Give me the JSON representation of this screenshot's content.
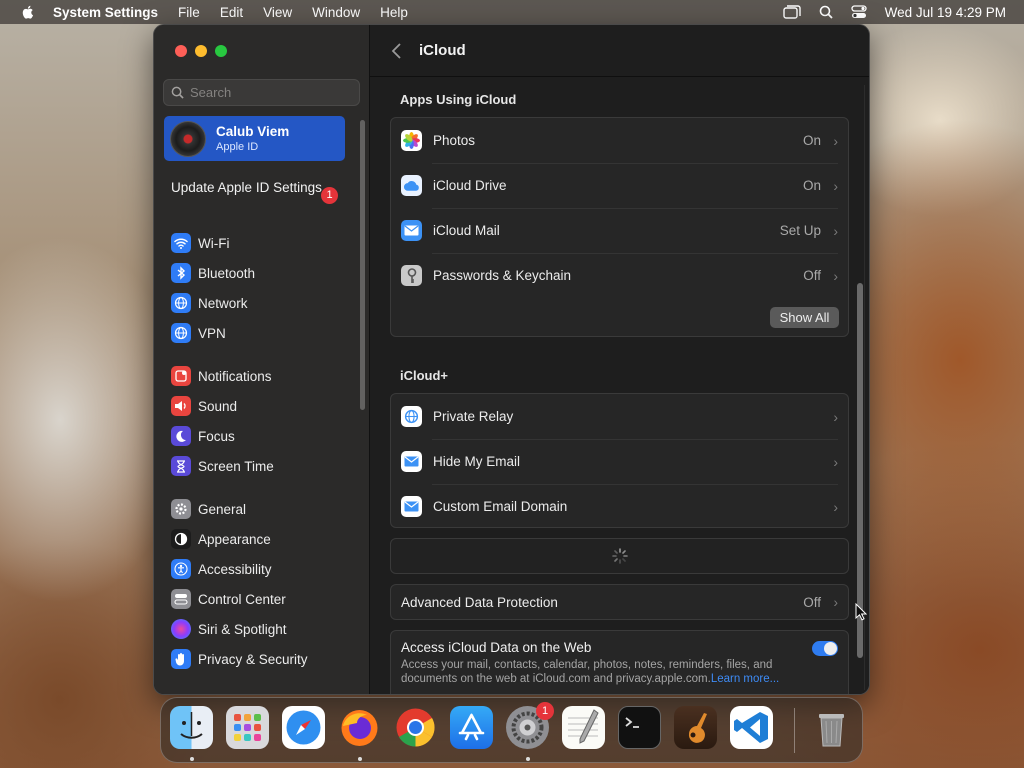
{
  "menubar": {
    "app_name": "System Settings",
    "menus": [
      "File",
      "Edit",
      "View",
      "Window",
      "Help"
    ],
    "clock": "Wed Jul 19  4:29 PM",
    "status_icons": [
      "window-icon",
      "search-icon",
      "control-center-icon"
    ]
  },
  "sidebar": {
    "search_placeholder": "Search",
    "account": {
      "name": "Calub Viem",
      "subtitle": "Apple ID"
    },
    "update": {
      "label": "Update Apple ID Settings",
      "badge": "1"
    },
    "items": [
      {
        "label": "Wi-Fi",
        "icon": "wifi-icon",
        "color": "#2f7cf6"
      },
      {
        "label": "Bluetooth",
        "icon": "bluetooth-icon",
        "color": "#2f7cf6"
      },
      {
        "label": "Network",
        "icon": "globe-icon",
        "color": "#2f7cf6"
      },
      {
        "label": "VPN",
        "icon": "vpn-globe-icon",
        "color": "#2f7cf6"
      },
      {
        "label": "Notifications",
        "icon": "bell-icon",
        "color": "#e9453f"
      },
      {
        "label": "Sound",
        "icon": "speaker-icon",
        "color": "#e9453f"
      },
      {
        "label": "Focus",
        "icon": "moon-icon",
        "color": "#5a4ad8"
      },
      {
        "label": "Screen Time",
        "icon": "hourglass-icon",
        "color": "#5a4ad8"
      },
      {
        "label": "General",
        "icon": "gear-icon",
        "color": "#8e8e93"
      },
      {
        "label": "Appearance",
        "icon": "appearance-icon",
        "color": "#1c1c1c"
      },
      {
        "label": "Accessibility",
        "icon": "accessibility-icon",
        "color": "#2f7cf6"
      },
      {
        "label": "Control Center",
        "icon": "control-center-icon",
        "color": "#8e8e93"
      },
      {
        "label": "Siri & Spotlight",
        "icon": "siri-icon",
        "color": "#b044d6"
      },
      {
        "label": "Privacy & Security",
        "icon": "hand-icon",
        "color": "#2f7cf6"
      }
    ]
  },
  "header": {
    "title": "iCloud"
  },
  "apps_section": {
    "title": "Apps Using iCloud",
    "rows": [
      {
        "label": "Photos",
        "value": "On",
        "icon": "photos-icon"
      },
      {
        "label": "iCloud Drive",
        "value": "On",
        "icon": "icloud-drive-icon"
      },
      {
        "label": "iCloud Mail",
        "value": "Set Up",
        "icon": "mail-icon"
      },
      {
        "label": "Passwords & Keychain",
        "value": "Off",
        "icon": "key-icon"
      }
    ],
    "show_all": "Show All"
  },
  "plus_section": {
    "title": "iCloud+",
    "rows": [
      {
        "label": "Private Relay",
        "icon": "private-relay-icon"
      },
      {
        "label": "Hide My Email",
        "icon": "hide-email-icon"
      },
      {
        "label": "Custom Email Domain",
        "icon": "custom-domain-icon"
      }
    ]
  },
  "advanced": {
    "label": "Advanced Data Protection",
    "value": "Off"
  },
  "web_access": {
    "title": "Access iCloud Data on the Web",
    "description": "Access your mail, contacts, calendar, photos, notes, reminders, files, and documents on the web at iCloud.com and privacy.apple.com.",
    "link": "Learn more...",
    "enabled": true
  },
  "dock": {
    "apps": [
      "finder-icon",
      "launchpad-icon",
      "safari-icon",
      "firefox-icon",
      "chrome-icon",
      "app-store-icon",
      "system-settings-icon",
      "textedit-icon",
      "terminal-icon",
      "garageband-icon",
      "vscode-icon",
      "trash-icon"
    ],
    "settings_badge": "1"
  }
}
